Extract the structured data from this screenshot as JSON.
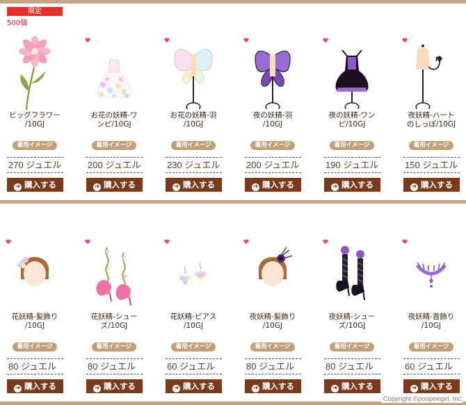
{
  "header": {
    "limited_label": "限定",
    "stock_label": "500個"
  },
  "common": {
    "tryon_label": "着用イメージ",
    "buy_label": "購入する"
  },
  "rows": [
    {
      "items": [
        {
          "name": "ビッグフラワー\n/10GJ",
          "price": "270 ジュエル",
          "icon": "big-flower-icon"
        },
        {
          "name": "お花の妖精-ワ\nンピ/10GJ",
          "price": "200 ジュエル",
          "icon": "flower-fairy-dress-icon"
        },
        {
          "name": "お花の妖精-羽\n/10GJ",
          "price": "230 ジュエル",
          "icon": "flower-fairy-wings-icon"
        },
        {
          "name": "夜の妖精-羽\n/10GJ",
          "price": "200 ジュエル",
          "icon": "night-fairy-wings-icon"
        },
        {
          "name": "夜の妖精-ワン\nピ/10GJ",
          "price": "190 ジュエル",
          "icon": "night-fairy-dress-icon"
        },
        {
          "name": "夜妖精-ハート\nのしっぽ/10GJ",
          "price": "150 ジュエル",
          "icon": "heart-tail-icon"
        }
      ]
    },
    {
      "items": [
        {
          "name": "花妖精-髪飾り\n/10GJ",
          "price": "80 ジュエル",
          "icon": "flower-hair-accessory-icon"
        },
        {
          "name": "花妖精-シュー\nズ/10GJ",
          "price": "80 ジュエル",
          "icon": "flower-shoes-icon"
        },
        {
          "name": "花妖精-ピアス\n/10GJ",
          "price": "60 ジュエル",
          "icon": "flower-earrings-icon"
        },
        {
          "name": "夜妖精-髪飾り\n/10GJ",
          "price": "80 ジュエル",
          "icon": "night-hair-accessory-icon"
        },
        {
          "name": "夜妖精-シュー\nズ/10GJ",
          "price": "80 ジュエル",
          "icon": "night-shoes-icon"
        },
        {
          "name": "夜妖精-首飾り\n/10GJ",
          "price": "60 ジュエル",
          "icon": "night-necklace-icon"
        }
      ]
    }
  ],
  "footer": {
    "copyright": "Copyright ©poupeegirl, Inc."
  },
  "colors": {
    "accent_bar": "#c4a484",
    "limited_red": "#e8302a",
    "buy_button": "#7a3a1c",
    "tryon_button": "#bfa07a",
    "heart_pink": "#e8428a"
  }
}
